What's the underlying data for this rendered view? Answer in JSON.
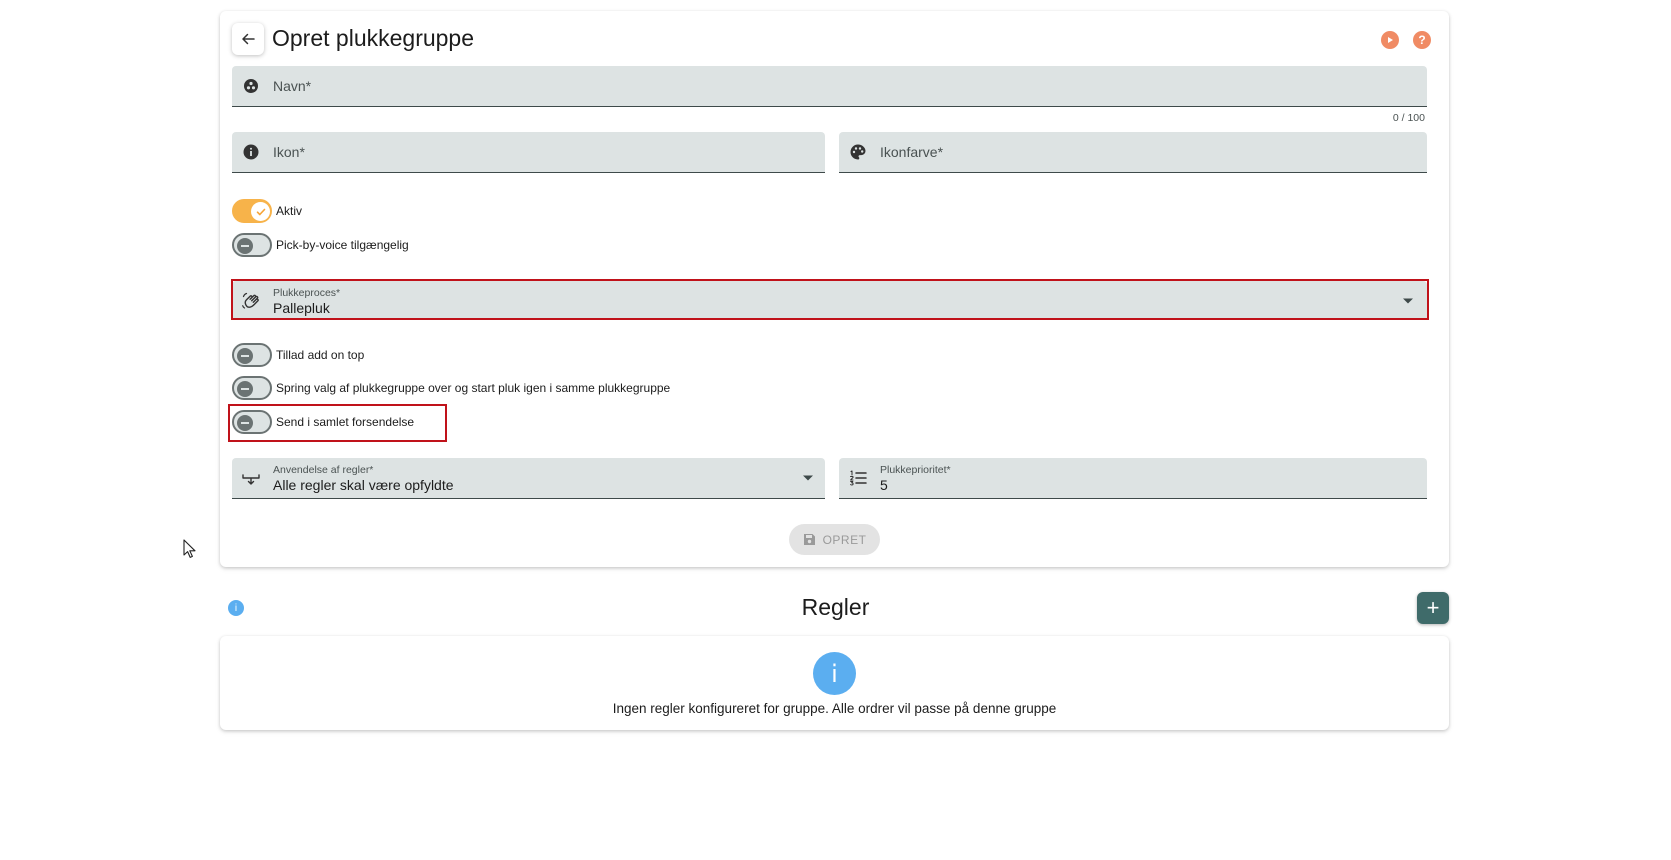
{
  "header": {
    "title": "Opret plukkegruppe"
  },
  "form": {
    "navn": {
      "placeholder": "Navn*",
      "counter": "0 / 100"
    },
    "ikon": {
      "placeholder": "Ikon*"
    },
    "ikonfarve": {
      "placeholder": "Ikonfarve*"
    },
    "toggles": {
      "aktiv": {
        "label": "Aktiv",
        "on": true
      },
      "pick_by_voice": {
        "label": "Pick-by-voice tilgængelig",
        "on": false
      },
      "add_on_top": {
        "label": "Tillad add on top",
        "on": false
      },
      "spring_valg": {
        "label": "Spring valg af plukkegruppe over og start pluk igen i samme plukkegruppe",
        "on": false
      },
      "samlet_forsendelse": {
        "label": "Send i samlet forsendelse",
        "on": false
      }
    },
    "plukkeproces": {
      "label": "Plukkeproces*",
      "value": "Pallepluk"
    },
    "anvendelse": {
      "label": "Anvendelse af regler*",
      "value": "Alle regler skal være opfyldte"
    },
    "prioritet": {
      "label": "Plukkeprioritet*",
      "value": "5"
    },
    "save_label": "OPRET"
  },
  "rules": {
    "title": "Regler",
    "empty_icon_glyph": "i",
    "info_glyph": "i",
    "add_glyph": "+",
    "empty_text": "Ingen regler konfigureret for gruppe. Alle ordrer vil passe på denne gruppe"
  },
  "colors": {
    "accent_orange": "#f08b64",
    "toggle_on": "#f7b34a",
    "field_bg": "#dde3e3",
    "add_button": "#3f6b6a",
    "info_blue": "#5baef0",
    "highlight_red": "#c0121a"
  }
}
